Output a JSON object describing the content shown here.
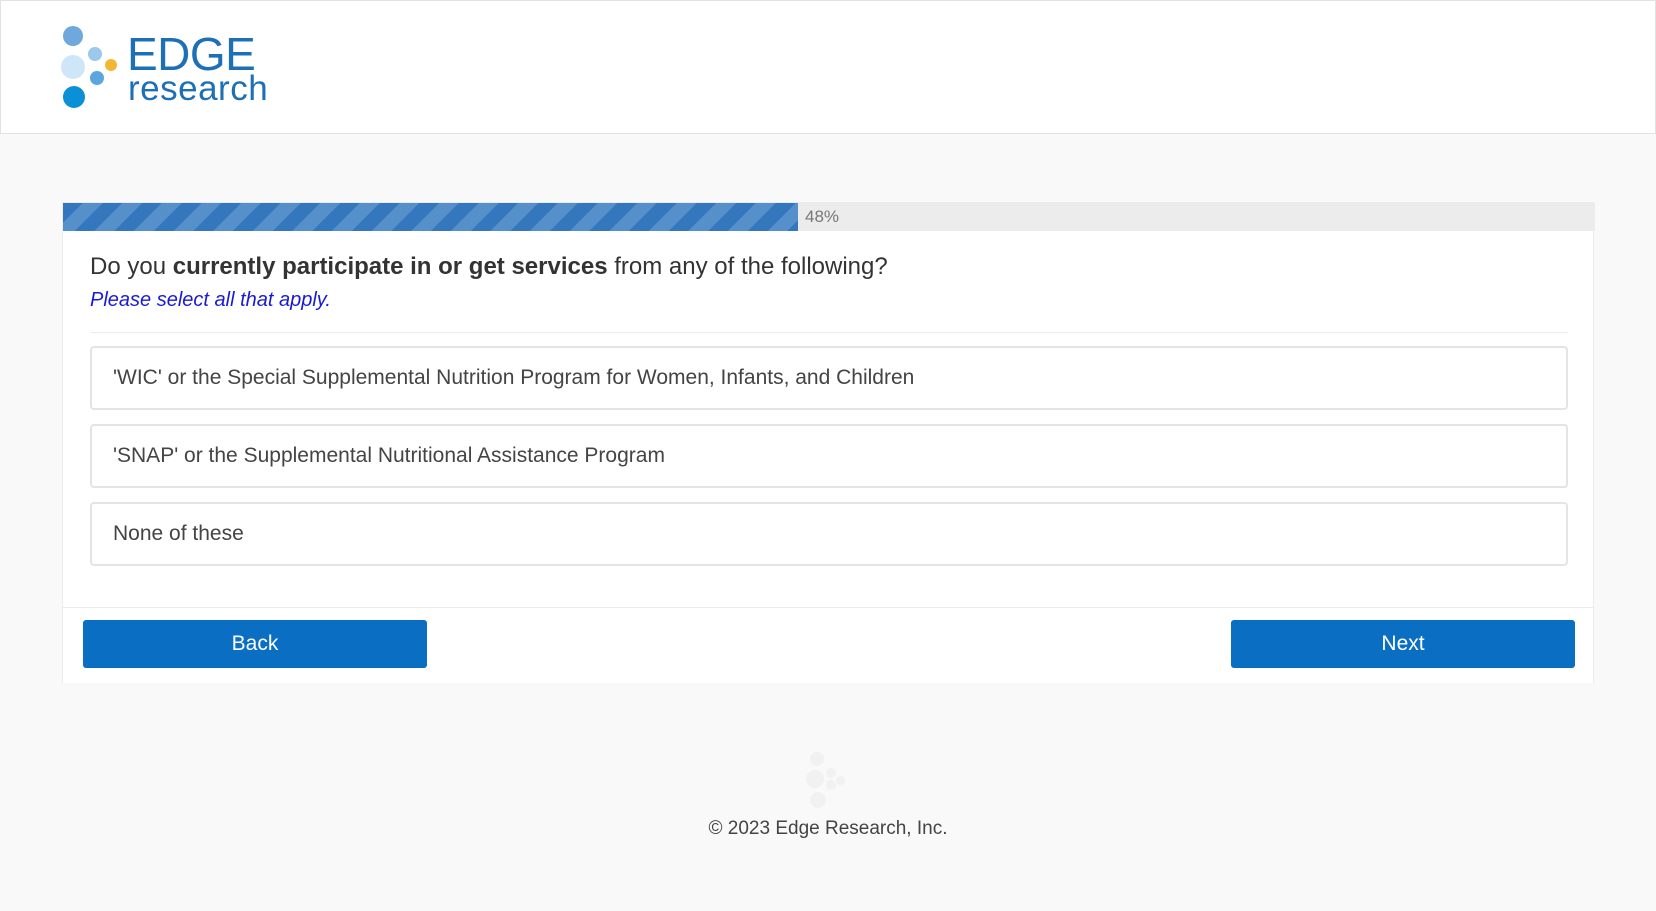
{
  "brand": {
    "name_line1": "EDGE",
    "name_line2": "research",
    "color": "#1d6fb6"
  },
  "survey": {
    "progress_percent": 48,
    "progress_label": "48%",
    "question_prefix": "Do you ",
    "question_bold": "currently participate in or get services",
    "question_suffix": " from any of the following?",
    "instruction": "Please select all that apply.",
    "options": [
      "'WIC' or the Special Supplemental Nutrition Program for Women, Infants, and Children",
      "'SNAP' or the Supplemental Nutritional Assistance Program",
      "None of these"
    ]
  },
  "nav": {
    "back_label": "Back",
    "next_label": "Next",
    "button_color": "#0a6fc2"
  },
  "footer": {
    "copyright": "© 2023 Edge Research, Inc."
  }
}
